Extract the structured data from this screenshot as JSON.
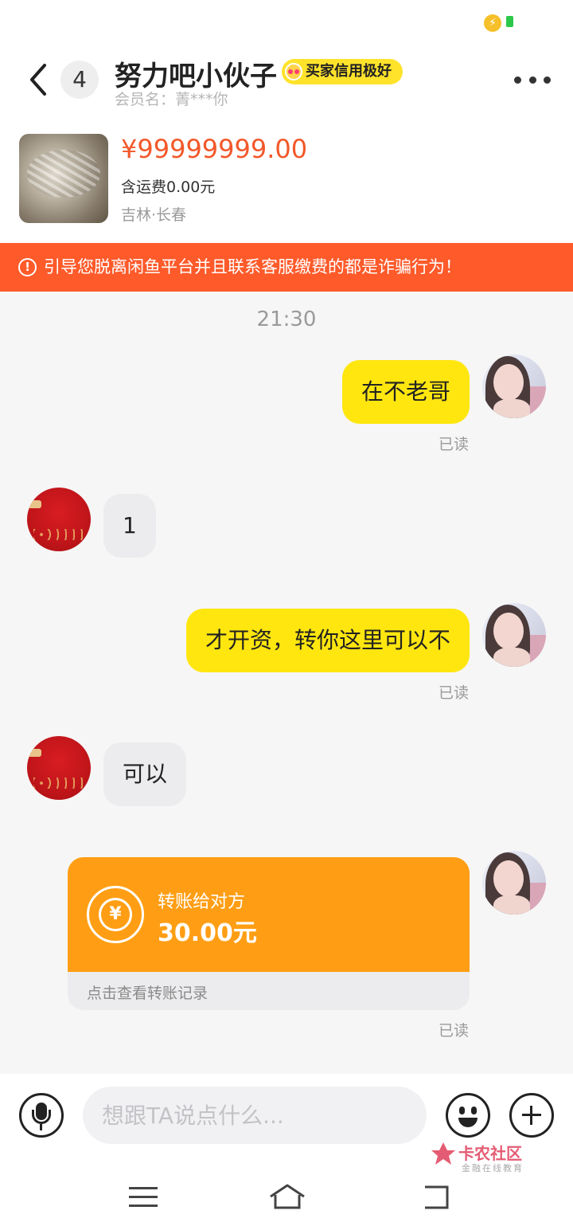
{
  "header": {
    "unread_count": "4",
    "title": "努力吧小伙子",
    "badge": "买家信用极好",
    "member": "会员名：菁***你"
  },
  "product": {
    "price": "¥99999999.00",
    "shipping": "含运费0.00元",
    "location": "吉林·长春"
  },
  "warning": {
    "icon": "!",
    "text": "引导您脱离闲鱼平台并且联系客服缴费的都是诈骗行为！"
  },
  "chat": {
    "time": "21:30",
    "messages": [
      {
        "from": "me",
        "text": "在不老哥",
        "status": "已读"
      },
      {
        "from": "other",
        "text": "1"
      },
      {
        "from": "me",
        "text": "才开资，转你这里可以不",
        "status": "已读"
      },
      {
        "from": "other",
        "text": "可以"
      }
    ],
    "transfer": {
      "icon_symbol": "¥",
      "label": "转账给对方",
      "amount": "30.00元",
      "record_link": "点击查看转账记录",
      "status": "已读"
    }
  },
  "input": {
    "placeholder": "想跟TA说点什么..."
  },
  "watermark": {
    "title": "卡农社区",
    "subtitle": "金融在线教育"
  },
  "colors": {
    "accent_yellow": "#ffe60f",
    "warning_bg": "#fe5a2a",
    "price": "#f2582a",
    "transfer": "#ff9e14"
  }
}
